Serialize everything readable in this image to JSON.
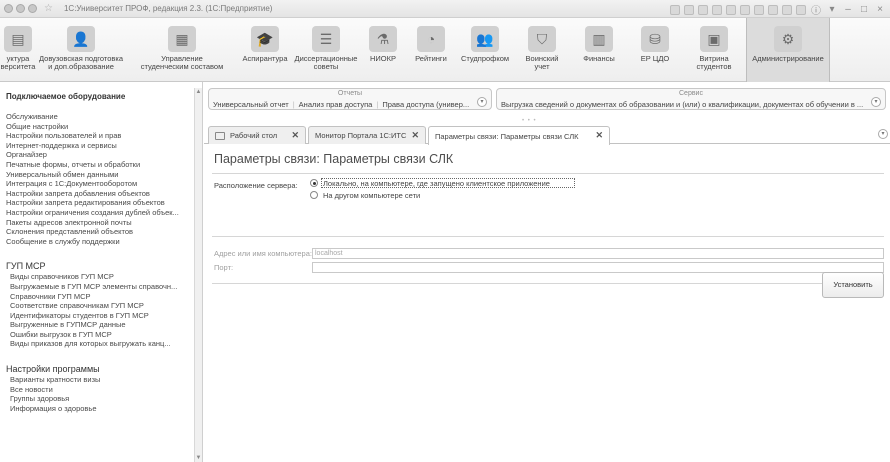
{
  "window": {
    "title": "1С:Университет ПРОФ, редакция 2.3. (1С:Предприятие)"
  },
  "sections": [
    {
      "label_1": "уктура",
      "label_2": "верситета",
      "icon": "structure-icon"
    },
    {
      "label_1": "Довузовская подготовка",
      "label_2": "и доп.образование",
      "icon": "preuniversity-icon"
    },
    {
      "label_1": "Управление",
      "label_2": "студенческим составом",
      "icon": "students-management-icon"
    },
    {
      "label_1": "Аспирантура",
      "label_2": "",
      "icon": "graduate-cap-icon"
    },
    {
      "label_1": "Диссертационные",
      "label_2": "советы",
      "icon": "dissertation-icon"
    },
    {
      "label_1": "НИОКР",
      "label_2": "",
      "icon": "research-icon"
    },
    {
      "label_1": "Рейтинги",
      "label_2": "",
      "icon": "ratings-icon"
    },
    {
      "label_1": "Студпрофком",
      "label_2": "",
      "icon": "union-icon"
    },
    {
      "label_1": "Воинский",
      "label_2": "учет",
      "icon": "shield-icon"
    },
    {
      "label_1": "Финансы",
      "label_2": "",
      "icon": "calculator-icon"
    },
    {
      "label_1": "ЕР ЦДО",
      "label_2": "",
      "icon": "coins-icon"
    },
    {
      "label_1": "Витрина",
      "label_2": "студентов",
      "icon": "showcase-icon"
    },
    {
      "label_1": "Администрирование",
      "label_2": "",
      "icon": "gear-icon"
    }
  ],
  "left_panel": {
    "heading": "Подключаемое оборудование",
    "items": [
      "Обслуживание",
      "Общие настройки",
      "Настройки пользователей и прав",
      "Интернет-поддержка и сервисы",
      "Органайзер",
      "Печатные формы, отчеты и обработки",
      "Универсальный обмен данными",
      "Интеграция с 1С:Документооборотом",
      "Настройки запрета добавления объектов",
      "Настройки запрета редактирования объектов",
      "Настройки ограничения создания дублей объек...",
      "Пакеты адресов электронной почты",
      "Склонения представлений объектов",
      "Сообщение в службу поддержки"
    ],
    "group1": {
      "title": "ГУП МСР",
      "items": [
        "Виды справочников ГУП МСР",
        "Выгружаемые в ГУП МСР элементы справочн...",
        "Справочники ГУП МСР",
        "Соответствие справочникам ГУП МСР",
        "Идентификаторы студентов в ГУП МСР",
        "Выгруженные в ГУПМСР данные",
        "Ошибки выгрузок в ГУП МСР",
        "Виды приказов для которых выгружать канц..."
      ]
    },
    "group2": {
      "title": "Настройки программы",
      "items": [
        "Варианты кратности визы",
        "Все новости",
        "Группы здоровья",
        "Информация о здоровье"
      ]
    }
  },
  "reports_panel": {
    "caption": "Отчеты",
    "links": [
      "Универсальный отчет",
      "Анализ прав доступа",
      "Права доступа (универ..."
    ]
  },
  "service_panel": {
    "caption": "Сервис",
    "links": [
      "Выгрузка сведений о документах об образовании и (или) о квалификации, документах об обучении в ..."
    ]
  },
  "tabs": [
    {
      "label": "Рабочий стол"
    },
    {
      "label": "Монитор Портала 1С:ИТС"
    },
    {
      "label": "Параметры связи: Параметры связи СЛК"
    }
  ],
  "form": {
    "title": "Параметры связи: Параметры связи СЛК",
    "server_location_label": "Расположение сервера:",
    "option_local": "Локально, на компьютере, где запущено клиентское приложение",
    "option_remote": "На другом компьютере сети",
    "address_label": "Адрес или имя компьютера:",
    "address_value": "localhost",
    "port_label": "Порт:",
    "port_value": "",
    "install_button": "Установить"
  }
}
